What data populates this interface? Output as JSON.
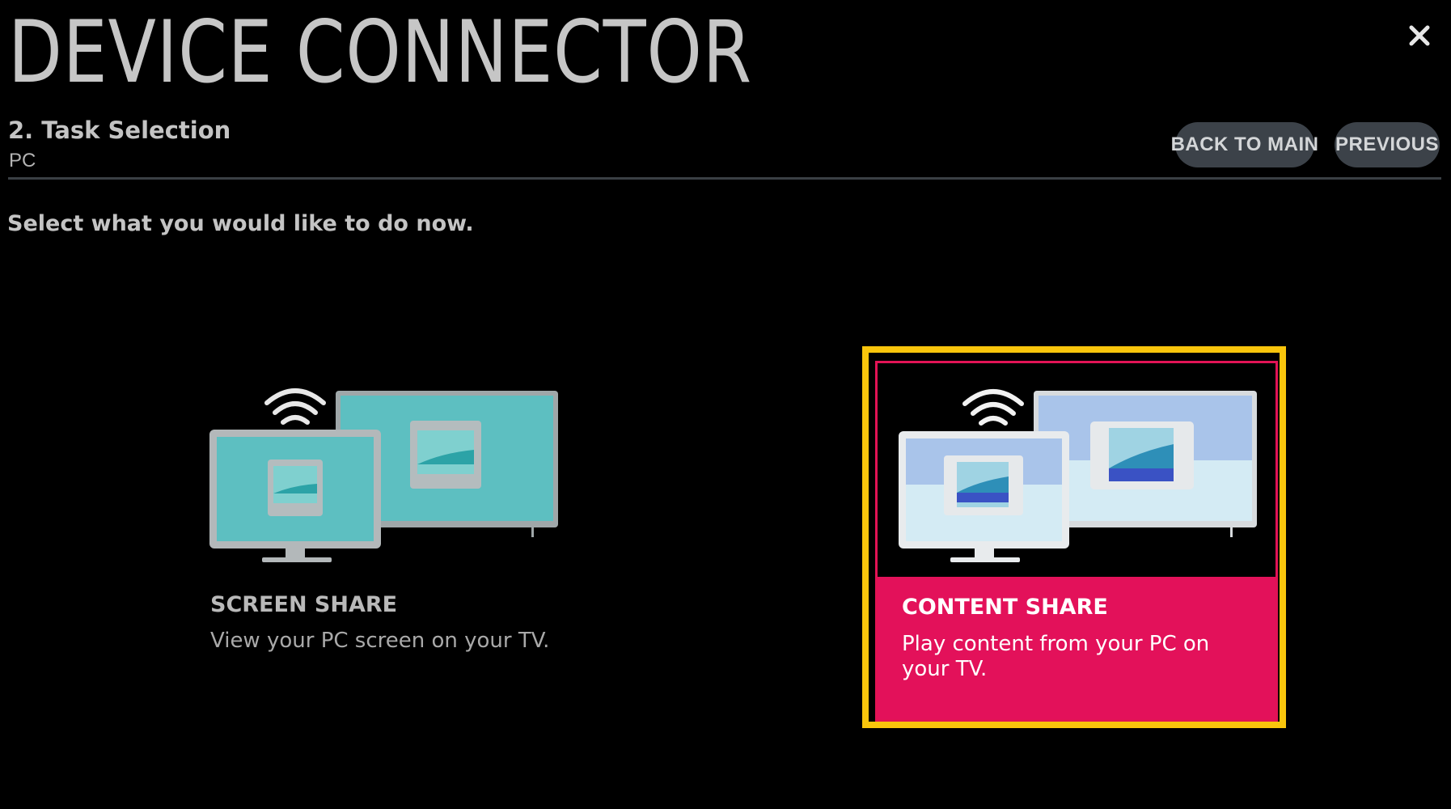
{
  "header": {
    "title": "DEVICE CONNECTOR",
    "step_title": "2. Task Selection",
    "step_subtitle": "PC",
    "close_icon": "close-icon",
    "buttons": {
      "back_to_main": "BACK TO MAIN",
      "previous": "PREVIOUS"
    }
  },
  "instruction": "Select what you would like to do now.",
  "options": [
    {
      "title": "SCREEN SHARE",
      "description": "View your PC screen on your TV.",
      "icon": "screen-share-icon",
      "selected": false
    },
    {
      "title": "CONTENT SHARE",
      "description": "Play content from your PC on your TV.",
      "icon": "content-share-icon",
      "selected": true
    }
  ],
  "colors": {
    "background": "#000000",
    "highlight": "#f9c50c",
    "selected_panel": "#e3115a",
    "button_bg": "#3c4249",
    "screen_share_teal": "#5dbfc1",
    "content_share_blue": "#a9c4ea"
  }
}
